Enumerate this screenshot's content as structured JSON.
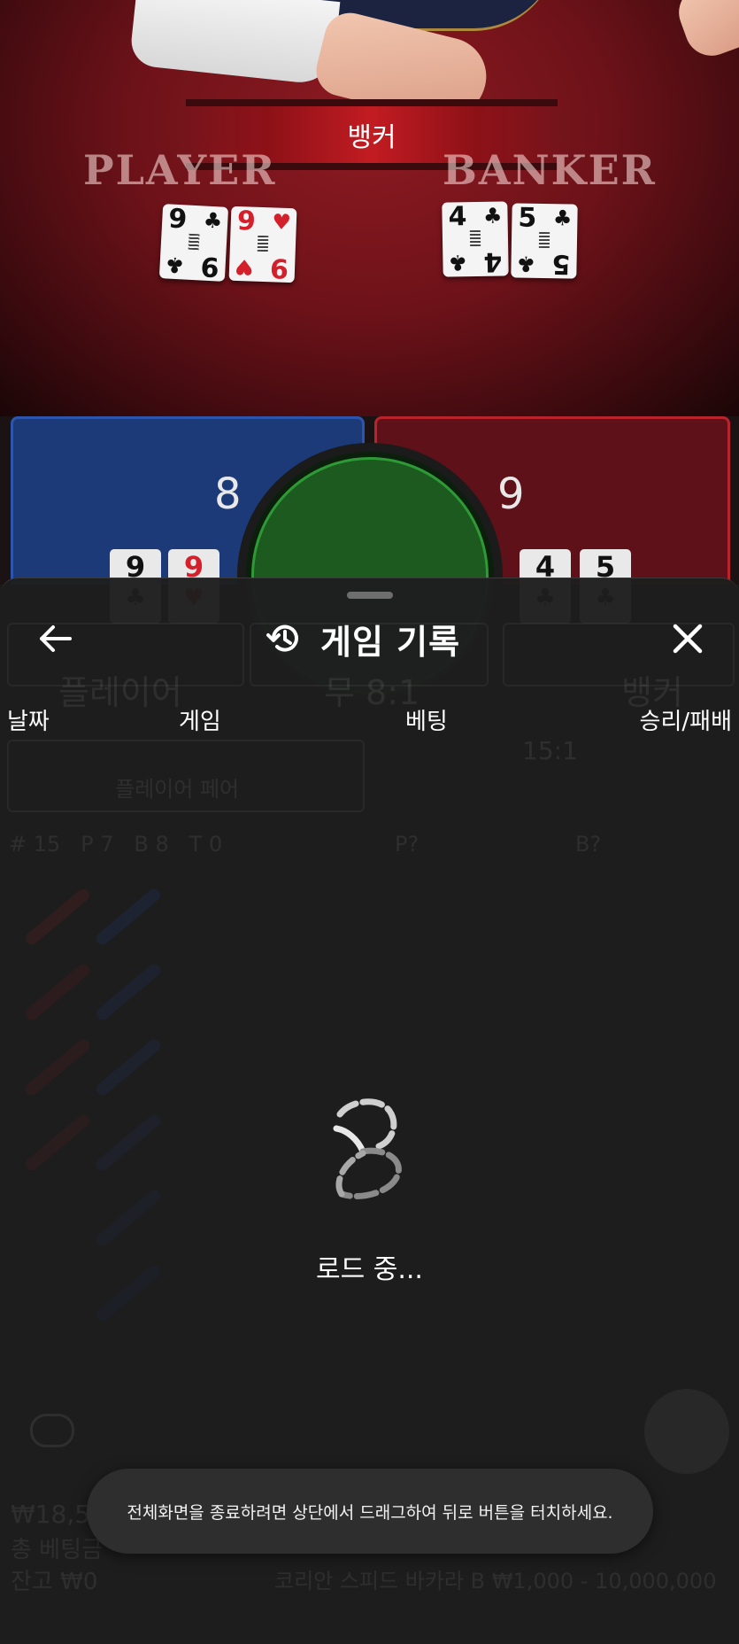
{
  "table": {
    "winner_banner": "뱅커",
    "player_label": "PLAYER",
    "banker_label": "BANKER",
    "player_cards": [
      {
        "rank": "9",
        "suit": "♣",
        "color": "black"
      },
      {
        "rank": "9",
        "suit": "♥",
        "color": "red"
      }
    ],
    "banker_cards": [
      {
        "rank": "4",
        "suit": "♣",
        "color": "black"
      },
      {
        "rank": "5",
        "suit": "♣",
        "color": "black"
      }
    ]
  },
  "betting": {
    "player_score": "8",
    "banker_score": "9",
    "player_cards": [
      {
        "rank": "9",
        "suit": "♣",
        "color": "black"
      },
      {
        "rank": "9",
        "suit": "♥",
        "color": "red"
      }
    ],
    "banker_cards": [
      {
        "rank": "4",
        "suit": "♣",
        "color": "black"
      },
      {
        "rank": "5",
        "suit": "♣",
        "color": "black"
      }
    ],
    "player_button": "플레이어",
    "tie_button": "무 8:1",
    "banker_button": "뱅커",
    "player_pair": "플레이어 페어",
    "pair_odds": "15:1",
    "stats": "# 15   P 7   B 8   T 0",
    "next_player": "P?",
    "next_banker": "B?",
    "balance_amount": "₩18,5",
    "total_bet_label": "총 베팅금",
    "remaining_label": "잔고 ₩0",
    "table_info": "코리안 스피드 바카라 B ₩1,000 - 10,000,000"
  },
  "history": {
    "back_icon": "arrow-left-icon",
    "history_icon": "history-icon",
    "title": "게임 기록",
    "close_icon": "close-icon",
    "columns": [
      "날짜",
      "게임",
      "베팅",
      "승리/패배"
    ],
    "loading": "로드 중..."
  },
  "toast": "전체화면을 종료하려면 상단에서 드래그하여 뒤로 버튼을 터치하세요.",
  "colors": {
    "player_blue": "#1d3a78",
    "banker_red": "#5e1118",
    "tie_green": "#1c5a20",
    "sheet_bg": "#1e1e1e"
  }
}
